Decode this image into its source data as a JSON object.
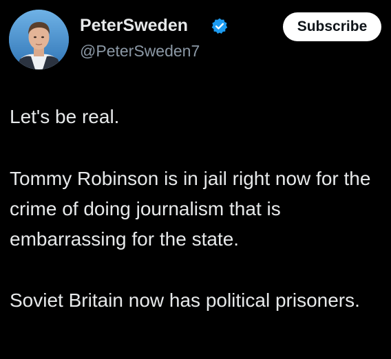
{
  "author": {
    "display_name": "PeterSweden",
    "handle": "@PeterSweden7",
    "verified": true,
    "avatar_icon": "profile-photo"
  },
  "actions": {
    "subscribe_label": "Subscribe"
  },
  "tweet": {
    "paragraph_1": "Let's be real.",
    "paragraph_2": "Tommy Robinson is in jail right now for the crime of doing journalism that is embarrassing for the state.",
    "paragraph_3": "Soviet Britain now has political prisoners."
  },
  "colors": {
    "background": "#000000",
    "text": "#e7e9ea",
    "secondary_text": "#8b98a5",
    "verified_badge": "#1d9bf0",
    "button_bg": "#ffffff",
    "button_text": "#0f1419"
  }
}
